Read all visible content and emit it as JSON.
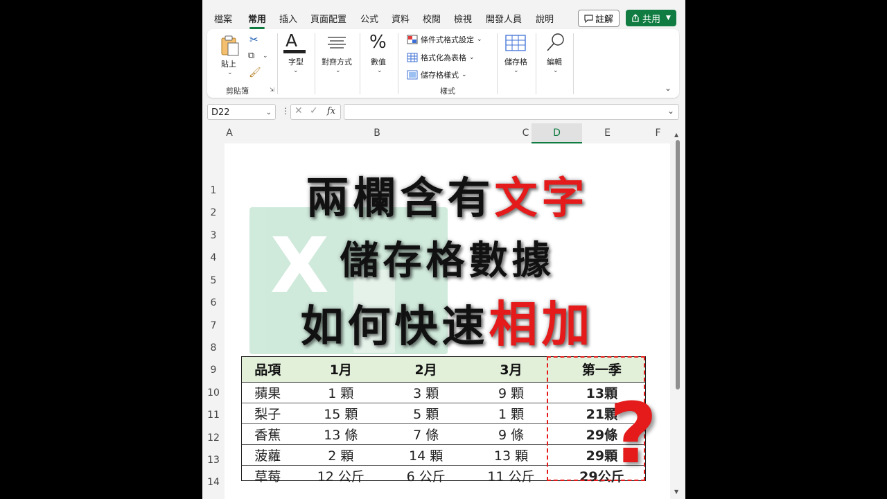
{
  "menu": {
    "tabs": [
      "檔案",
      "常用",
      "插入",
      "頁面配置",
      "公式",
      "資料",
      "校閱",
      "檢視",
      "開發人員",
      "說明"
    ],
    "comment": "註解",
    "share": "共用"
  },
  "ribbon": {
    "paste": "貼上",
    "clipboard_group": "剪貼簿",
    "font": "字型",
    "alignment": "對齊方式",
    "number": "數值",
    "conditional_format": "條件式格式設定",
    "format_as_table": "格式化為表格",
    "cell_styles": "儲存格樣式",
    "styles_group": "樣式",
    "cells": "儲存格",
    "editing": "編輯"
  },
  "formula_bar": {
    "name_box": "D22",
    "fx": "fx",
    "formula": ""
  },
  "columns": [
    "A",
    "B",
    "C",
    "D",
    "E",
    "F"
  ],
  "rows": [
    "1",
    "2",
    "3",
    "4",
    "5",
    "6",
    "7",
    "8",
    "9",
    "10",
    "11",
    "12",
    "13",
    "14"
  ],
  "title": {
    "line1_black": "兩欄含有",
    "line1_red": "文字",
    "line2": "儲存格數據",
    "line3_black": "如何快速",
    "line3_red": "相加"
  },
  "table": {
    "headers": [
      "品項",
      "1月",
      "2月",
      "3月",
      "第一季"
    ],
    "rows": [
      [
        "蘋果",
        "1 顆",
        "3 顆",
        "9 顆",
        "13顆"
      ],
      [
        "梨子",
        "15 顆",
        "5 顆",
        "1 顆",
        "21顆"
      ],
      [
        "香蕉",
        "13 條",
        "7 條",
        "9 條",
        "29條"
      ],
      [
        "菠蘿",
        "2 顆",
        "14 顆",
        "13 顆",
        "29顆"
      ],
      [
        "草莓",
        "12 公斤",
        "6 公斤",
        "11 公斤",
        "29公斤"
      ]
    ]
  },
  "question_mark": "?",
  "colors": {
    "accent": "#107c41",
    "highlight": "#e51a1a",
    "header_fill": "#e2efd9"
  }
}
